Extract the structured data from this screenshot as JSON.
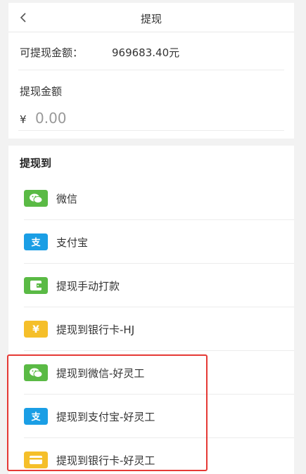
{
  "header": {
    "title": "提现"
  },
  "balance": {
    "label": "可提现金额：",
    "value": "969683.40元"
  },
  "amount": {
    "label": "提现金额",
    "currency_symbol": "¥",
    "placeholder": "0.00",
    "value": ""
  },
  "methods_section": {
    "title": "提现到",
    "items": [
      {
        "label": "微信",
        "icon": "wechat-icon",
        "color": "#5aba45"
      },
      {
        "label": "支付宝",
        "icon": "alipay-icon",
        "color": "#1a9ee5"
      },
      {
        "label": "提现手动打款",
        "icon": "wallet-icon",
        "color": "#5aba45"
      },
      {
        "label": "提现到银行卡-HJ",
        "icon": "yen-icon",
        "color": "#f5bf2a"
      },
      {
        "label": "提现到微信-好灵工",
        "icon": "wechat-icon",
        "color": "#5aba45"
      },
      {
        "label": "提现到支付宝-好灵工",
        "icon": "alipay-icon",
        "color": "#1a9ee5"
      },
      {
        "label": "提现到银行卡-好灵工",
        "icon": "bank-card-icon",
        "color": "#f5bf2a"
      }
    ]
  },
  "highlight": {
    "color": "#e53935"
  }
}
